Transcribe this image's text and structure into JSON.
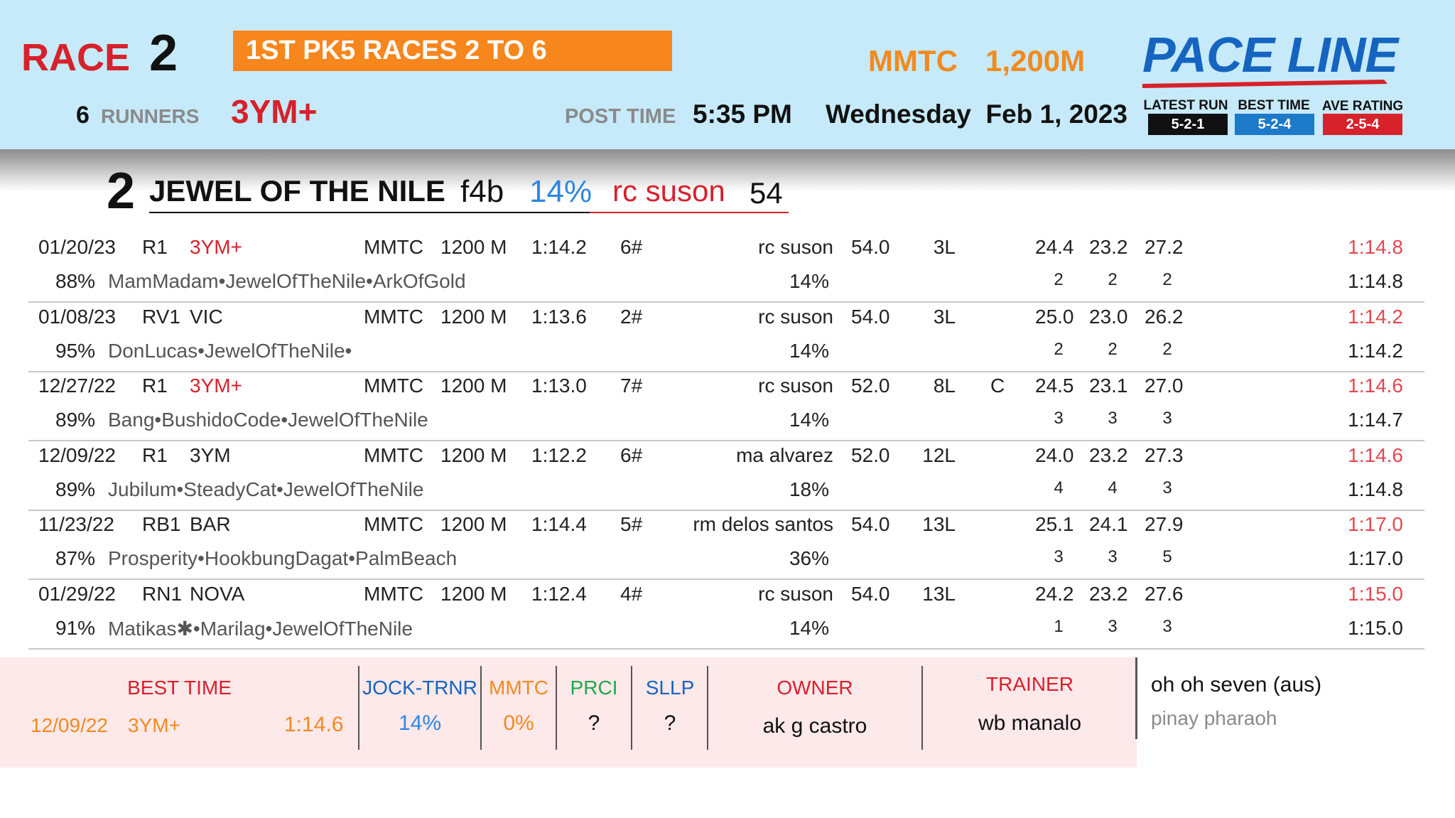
{
  "header": {
    "race_label": "RACE",
    "race_number": "2",
    "banner": "1ST PK5 RACES 2 TO 6",
    "runners_count": "6",
    "runners_label": "RUNNERS",
    "race_class": "3YM+",
    "venue": "MMTC",
    "distance": "1,200M",
    "post_time_label": "POST TIME",
    "post_time": "5:35 PM",
    "date": "Wednesday  Feb 1, 2023"
  },
  "logo": {
    "text": "PACE LINE",
    "legend": [
      {
        "label": "LATEST RUN",
        "value": "5-2-1",
        "color": "#111111"
      },
      {
        "label": "BEST TIME",
        "value": "5-2-4",
        "color": "#1d7ac9"
      },
      {
        "label": "AVE RATING",
        "value": "2-5-4",
        "color": "#d7212b"
      }
    ]
  },
  "horse": {
    "number": "2",
    "name": "JEWEL OF THE NILE",
    "sex_age": "f4b",
    "pct": "14%",
    "jockey": "rc suson",
    "weight": "54"
  },
  "runs": [
    {
      "date": "01/20/23",
      "race": "R1",
      "class": "3YM+",
      "class_red": true,
      "venue": "MMTC",
      "dist": "1200 M",
      "time": "1:14.2",
      "post": "6#",
      "jockey": "rc suson",
      "weight": "54.0",
      "margin": "3L",
      "flag": "",
      "s1": "24.4",
      "s2": "23.2",
      "s3": "27.2",
      "final": "1:14.8",
      "rating": "88%",
      "finishers": "MamMadam•JewelOfTheNile•ArkOfGold",
      "jpct": "14%",
      "p1": "2",
      "p2": "2",
      "p3": "2",
      "adj": "1:14.8"
    },
    {
      "date": "01/08/23",
      "race": "RV1",
      "class": "VIC",
      "class_red": false,
      "venue": "MMTC",
      "dist": "1200 M",
      "time": "1:13.6",
      "post": "2#",
      "jockey": "rc suson",
      "weight": "54.0",
      "margin": "3L",
      "flag": "",
      "s1": "25.0",
      "s2": "23.0",
      "s3": "26.2",
      "final": "1:14.2",
      "rating": "95%",
      "finishers": "DonLucas•JewelOfTheNile•",
      "jpct": "14%",
      "p1": "2",
      "p2": "2",
      "p3": "2",
      "adj": "1:14.2"
    },
    {
      "date": "12/27/22",
      "race": "R1",
      "class": "3YM+",
      "class_red": true,
      "venue": "MMTC",
      "dist": "1200 M",
      "time": "1:13.0",
      "post": "7#",
      "jockey": "rc suson",
      "weight": "52.0",
      "margin": "8L",
      "flag": "C",
      "s1": "24.5",
      "s2": "23.1",
      "s3": "27.0",
      "final": "1:14.6",
      "rating": "89%",
      "finishers": "Bang•BushidoCode•JewelOfTheNile",
      "jpct": "14%",
      "p1": "3",
      "p2": "3",
      "p3": "3",
      "adj": "1:14.7"
    },
    {
      "date": "12/09/22",
      "race": "R1",
      "class": "3YM",
      "class_red": false,
      "venue": "MMTC",
      "dist": "1200 M",
      "time": "1:12.2",
      "post": "6#",
      "jockey": "ma alvarez",
      "weight": "52.0",
      "margin": "12L",
      "flag": "",
      "s1": "24.0",
      "s2": "23.2",
      "s3": "27.3",
      "final": "1:14.6",
      "rating": "89%",
      "finishers": "Jubilum•SteadyCat•JewelOfTheNile",
      "jpct": "18%",
      "p1": "4",
      "p2": "4",
      "p3": "3",
      "adj": "1:14.8"
    },
    {
      "date": "11/23/22",
      "race": "RB1",
      "class": "BAR",
      "class_red": false,
      "venue": "MMTC",
      "dist": "1200 M",
      "time": "1:14.4",
      "post": "5#",
      "jockey": "rm delos santos",
      "weight": "54.0",
      "margin": "13L",
      "flag": "",
      "s1": "25.1",
      "s2": "24.1",
      "s3": "27.9",
      "final": "1:17.0",
      "rating": "87%",
      "finishers": "Prosperity•HookbungDagat•PalmBeach",
      "jpct": "36%",
      "p1": "3",
      "p2": "3",
      "p3": "5",
      "adj": "1:17.0"
    },
    {
      "date": "01/29/22",
      "race": "RN1",
      "class": "NOVA",
      "class_red": false,
      "venue": "MMTC",
      "dist": "1200 M",
      "time": "1:12.4",
      "post": "4#",
      "jockey": "rc suson",
      "weight": "54.0",
      "margin": "13L",
      "flag": "",
      "s1": "24.2",
      "s2": "23.2",
      "s3": "27.6",
      "final": "1:15.0",
      "rating": "91%",
      "finishers": "Matikas✱•Marilag•JewelOfTheNile",
      "jpct": "14%",
      "p1": "1",
      "p2": "3",
      "p3": "3",
      "adj": "1:15.0"
    }
  ],
  "footer": {
    "best_time_label": "BEST TIME",
    "best_date": "12/09/22",
    "best_class": "3YM+",
    "best_time": "1:14.6",
    "jock_trnr_label": "JOCK-TRNR",
    "jock_trnr": "14%",
    "mmtc_label": "MMTC",
    "mmtc": "0%",
    "prci_label": "PRCI",
    "prci": "?",
    "sllp_label": "SLLP",
    "sllp": "?",
    "owner_label": "OWNER",
    "owner": "ak g castro",
    "trainer_label": "TRAINER",
    "trainer": "wb manalo",
    "sire": "oh oh seven (aus)",
    "dam": "pinay pharaoh"
  }
}
